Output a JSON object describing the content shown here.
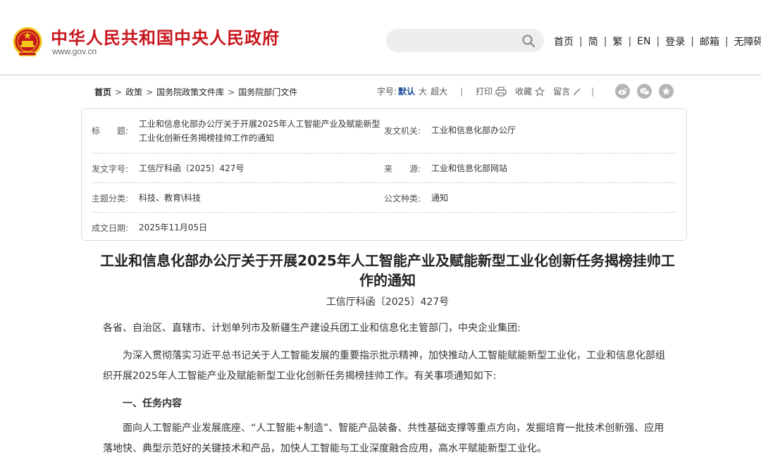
{
  "header": {
    "site_name": "中华人民共和国中央人民政府",
    "site_url": "www.gov.cn",
    "search_placeholder": "",
    "nav": [
      "首页",
      "简",
      "繁",
      "EN",
      "登录",
      "邮箱",
      "无障碍"
    ],
    "separator": "|"
  },
  "breadcrumb": {
    "items": [
      "首页",
      "政策",
      "国务院政策文件库",
      "国务院部门文件"
    ],
    "separator": ">"
  },
  "toolbar": {
    "font_size_label": "字号:",
    "font_sizes": [
      "默认",
      "大",
      "超大"
    ],
    "print_label": "打印",
    "favorite_label": "收藏",
    "comment_label": "留言",
    "divider": "|"
  },
  "meta": {
    "title_label": "标　　题:",
    "title_value_line1": "工业和信息化部办公厅关于开展2025年人工智能产业及赋能新型",
    "title_value_line2": "工业化创新任务揭榜挂帅工作的通知",
    "issuer_label": "发文机关:",
    "issuer_value": "工业和信息化部办公厅",
    "docno_label": "发文字号:",
    "docno_value": "工信厅科函〔2025〕427号",
    "source_label": "来　　源:",
    "source_value": "工业和信息化部网站",
    "topic_label": "主题分类:",
    "topic_value": "科技、教育\\科技",
    "type_label": "公文种类:",
    "type_value": "通知",
    "date_label": "成文日期:",
    "date_value": "2025年11月05日"
  },
  "article": {
    "title": "工业和信息化部办公厅关于开展2025年人工智能产业及赋能新型工业化创新任务揭榜挂帅工作的通知",
    "docno": "工信厅科函〔2025〕427号",
    "salutation": "各省、自治区、直辖市、计划单列市及新疆生产建设兵团工业和信息化主管部门，中央企业集团:",
    "para1": "为深入贯彻落实习近平总书记关于人工智能发展的重要指示批示精神，加快推动人工智能赋能新型工业化，工业和信息化部组织开展2025年人工智能产业及赋能新型工业化创新任务揭榜挂帅工作。有关事项通知如下:",
    "heading1": "一、任务内容",
    "para2": "面向人工智能产业发展底座、“人工智能+制造”、智能产品装备、共性基础支撑等重点方向，发掘培育一批技术创新强、应用落地快、典型示范好的关键技术和产品，加快人工智能与工业深度融合应用，高水平赋能新型工业化。"
  },
  "colors": {
    "brand_red": "#c8161e",
    "emblem_gold": "#f0c419",
    "link_blue": "#1a4f9c",
    "share_grey": "#b5b5b5"
  },
  "icons": [
    "national-emblem-icon",
    "search-icon",
    "printer-icon",
    "star-icon",
    "pencil-icon",
    "weibo-icon",
    "wechat-icon",
    "favorite-share-icon"
  ]
}
